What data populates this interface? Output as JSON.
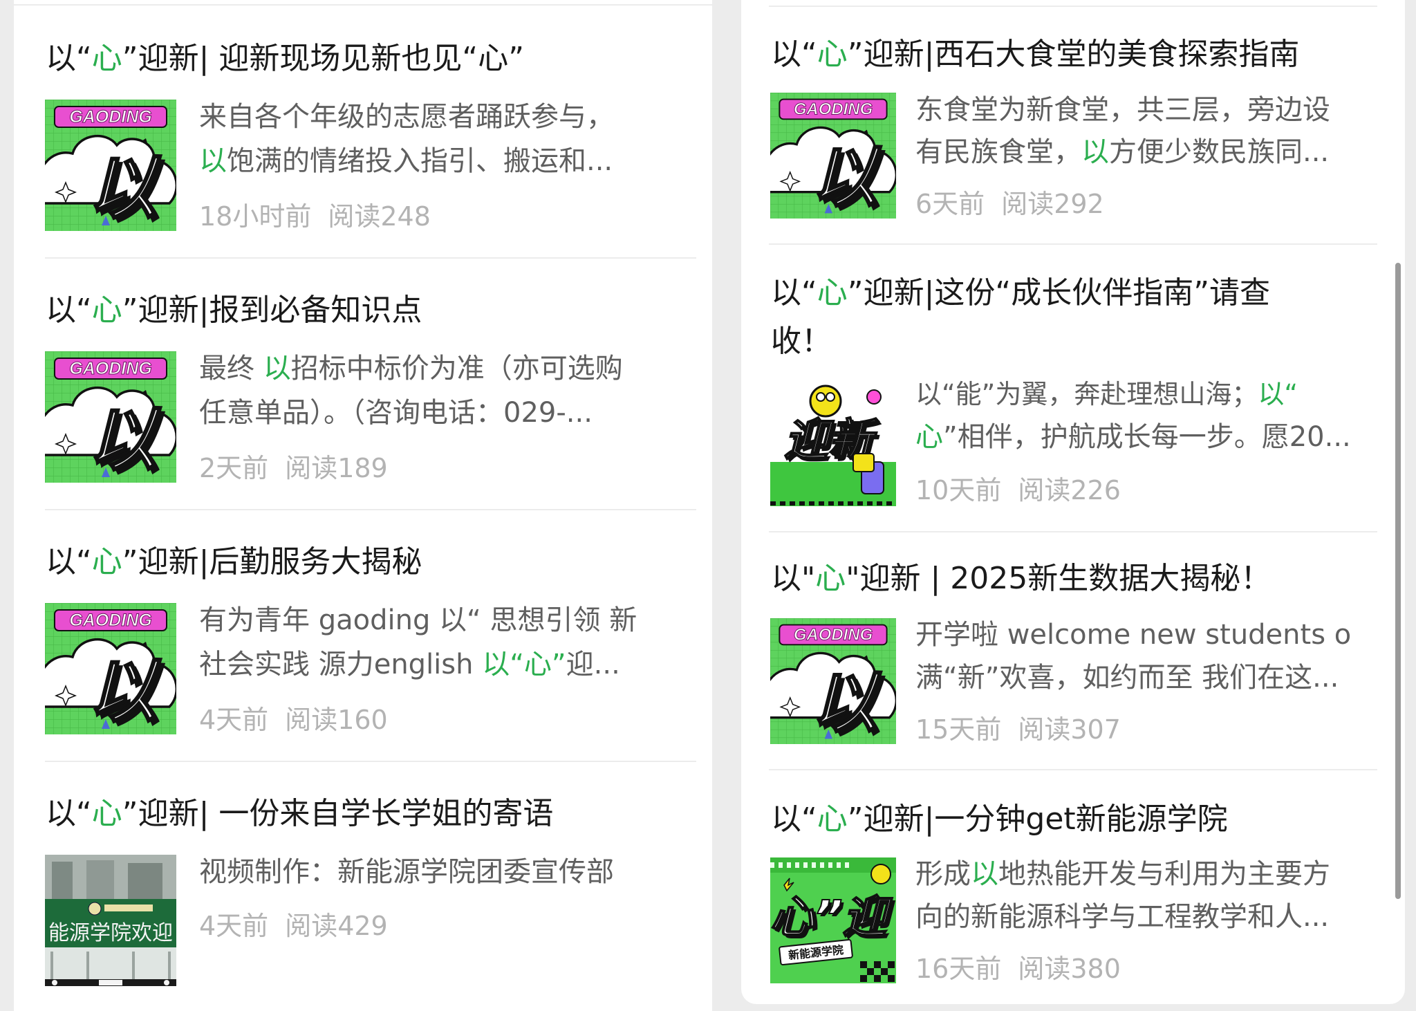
{
  "left_column": [
    {
      "title_parts": [
        "以“",
        "心",
        "”迎新| 迎新现场见新也见“心”"
      ],
      "desc_line1": "来自各个年级的志愿者踊跃参与，",
      "desc_line2_hl": "以",
      "desc_line2": "饱满的情绪投入指引、搬运和...",
      "time": "18小时前",
      "reads": "阅读248",
      "thumb": "gaoding-yi"
    },
    {
      "title_parts": [
        "以“",
        "心",
        "”迎新|报到必备知识点"
      ],
      "desc_line1_pre": "最终 ",
      "desc_line1_hl": "以",
      "desc_line1": "招标中标价为准（亦可选购",
      "desc_line2": "任意单品）。（咨询电话：029-...",
      "time": "2天前",
      "reads": "阅读189",
      "thumb": "gaoding-yi"
    },
    {
      "title_parts": [
        "以“",
        "心",
        "”迎新|后勤服务大揭秘"
      ],
      "desc_line1": "有为青年 gaoding 以“ 思想引领 新",
      "desc_line2_pre": "社会实践 源力english ",
      "desc_line2_hl": "以“心”",
      "desc_line2": "迎...",
      "time": "4天前",
      "reads": "阅读160",
      "thumb": "gaoding-yi"
    },
    {
      "title_parts": [
        "以“",
        "心",
        "”迎新| 一份来自学长学姐的寄语"
      ],
      "desc_line1": "视频制作：新能源学院团委宣传部",
      "time": "4天前",
      "reads": "阅读429",
      "thumb": "building-photo",
      "photo_banner": "能源学院欢迎"
    }
  ],
  "right_column": [
    {
      "title_parts": [
        "以“",
        "心",
        "”迎新|西石大食堂的美食探索指南"
      ],
      "desc_line1": "东食堂为新食堂，共三层，旁边设",
      "desc_line2_pre": "有民族食堂，",
      "desc_line2_hl": "以",
      "desc_line2": "方便少数民族同...",
      "time": "6天前",
      "reads": "阅读292",
      "thumb": "gaoding-yi"
    },
    {
      "title_line1_parts": [
        "以“",
        "心",
        "”迎新|这份“成长伙伴指南”请查"
      ],
      "title_line2": "收！",
      "desc_line1_pre": "以“能”为翼，奔赴理想山海；",
      "desc_line1_hl": "以“",
      "desc_line2_hl": "心",
      "desc_line2": "”相伴，护航成长每一步。愿20...",
      "time": "10天前",
      "reads": "阅读226",
      "thumb": "yingxin",
      "thumb_text": "迎新"
    },
    {
      "title_parts": [
        "以\"",
        "心",
        "\"迎新 | 2025新生数据大揭秘！"
      ],
      "desc_line1": "开学啦 welcome new students o",
      "desc_line2": "满“新”欢喜，如约而至 我们在这...",
      "time": "15天前",
      "reads": "阅读307",
      "thumb": "gaoding-yi"
    },
    {
      "title_parts": [
        "以“",
        "心",
        "”迎新|一分钟get新能源学院"
      ],
      "desc_line1_pre": "形成",
      "desc_line1_hl": "以",
      "desc_line1": "地热能开发与利用为主要方",
      "desc_line2": "向的新能源科学与工程教学和人...",
      "time": "16天前",
      "reads": "阅读380",
      "thumb": "xin-ying",
      "thumb_text": "心”迎",
      "thumb_tag": "新能源学院"
    }
  ],
  "thumb_brand": "GAODING",
  "thumb_big_char": "以",
  "colors": {
    "highlight": "#2bae4f",
    "thumb_green": "#5ed35e",
    "thumb_pink": "#e84fd0",
    "meta_gray": "#b3b3b3"
  }
}
